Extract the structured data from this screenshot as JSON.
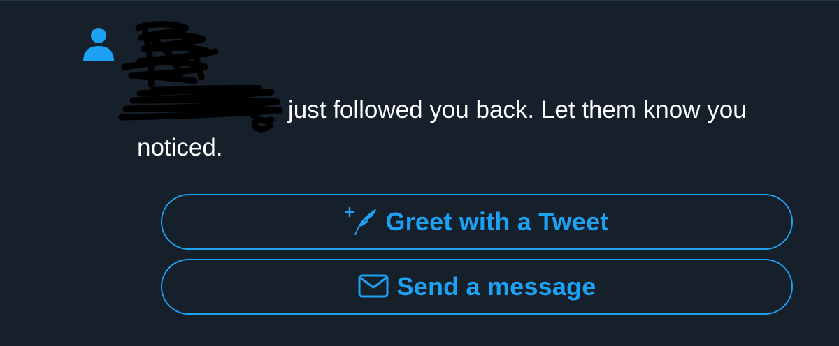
{
  "notification": {
    "message_prefix": "",
    "message_text": "just followed you back. Let them know you noticed.",
    "person_icon": "person-icon",
    "redacted_avatar": "scribble-redaction",
    "redacted_name": "scribble-redaction"
  },
  "actions": {
    "greet": {
      "label": "Greet with a Tweet",
      "icon": "compose-tweet-feather-icon"
    },
    "message": {
      "label": "Send a message",
      "icon": "envelope-icon"
    }
  },
  "colors": {
    "background": "#15202b",
    "accent": "#1da1f2",
    "text": "#ffffff"
  }
}
